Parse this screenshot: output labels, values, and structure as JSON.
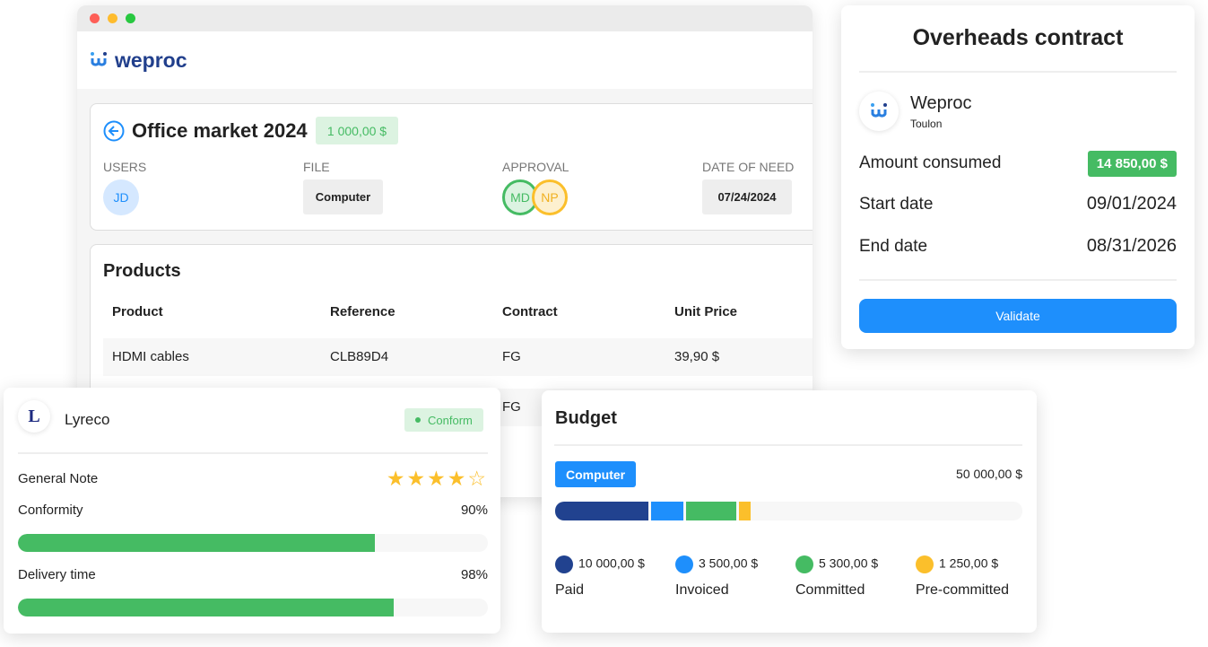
{
  "app": {
    "brand": "weproc"
  },
  "request": {
    "title": "Office market 2024",
    "amount": "1 000,00 $",
    "fields": {
      "users_label": "USERS",
      "user_initials": "JD",
      "file_label": "FILE",
      "file_value": "Computer",
      "approval_label": "APPROVAL",
      "approvers": [
        "MD",
        "NP"
      ],
      "date_label": "DATE OF NEED",
      "date_value": "07/24/2024"
    }
  },
  "products": {
    "title": "Products",
    "columns": [
      "Product",
      "Reference",
      "Contract",
      "Unit Price"
    ],
    "rows": [
      [
        "HDMI cables",
        "CLB89D4",
        "FG",
        "39,90 $"
      ],
      [
        "",
        "",
        "FG",
        ""
      ]
    ]
  },
  "contract": {
    "title": "Overheads contract",
    "supplier": "Weproc",
    "city": "Toulon",
    "amount_label": "Amount consumed",
    "amount": "14 850,00 $",
    "start_label": "Start date",
    "start": "09/01/2024",
    "end_label": "End date",
    "end": "08/31/2026",
    "validate": "Validate"
  },
  "supplier": {
    "name": "Lyreco",
    "logo_letter": "L",
    "status": "Conform",
    "note_label": "General Note",
    "rating": 4,
    "rating_max": 5,
    "conformity_label": "Conformity",
    "conformity": "90%",
    "delivery_label": "Delivery time",
    "delivery": "98%",
    "bar_fill": {
      "conformity": 0.76,
      "delivery": 0.8
    }
  },
  "budget": {
    "title": "Budget",
    "category": "Computer",
    "total": "50 000,00 $",
    "total_value": 50000,
    "items": [
      {
        "label": "Paid",
        "amount": "10 000,00 $",
        "value": 10000,
        "color": "#21428f"
      },
      {
        "label": "Invoiced",
        "amount": "3 500,00 $",
        "value": 3500,
        "color": "#1e8ffc"
      },
      {
        "label": "Committed",
        "amount": "5 300,00 $",
        "value": 5300,
        "color": "#45bb63"
      },
      {
        "label": "Pre-committed",
        "amount": "1 250,00 $",
        "value": 1250,
        "color": "#fbbf2b"
      }
    ]
  },
  "colors": {
    "accent": "#1e8ffc",
    "success": "#45bb63",
    "brand": "#213f8c"
  }
}
